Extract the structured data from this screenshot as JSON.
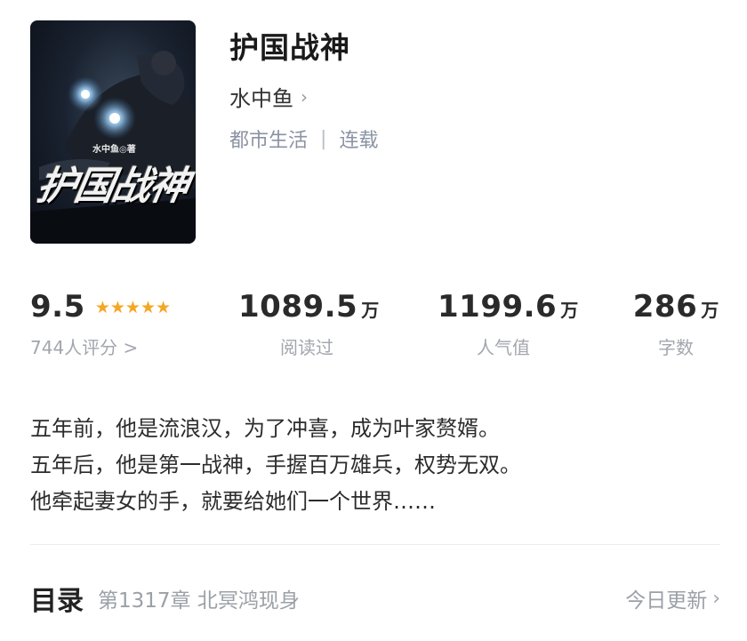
{
  "book": {
    "title": "护国战神",
    "cover_title": "护国战神",
    "cover_author": "水中鱼◎著",
    "author": "水中鱼",
    "author_chevron": "›",
    "category": "都市生活",
    "separator": "|",
    "status": "连载"
  },
  "stats": {
    "rating": {
      "value": "9.5",
      "stars": 5,
      "label": "744人评分 >"
    },
    "read": {
      "value": "1089.5",
      "unit": "万",
      "label": "阅读过"
    },
    "popularity": {
      "value": "1199.6",
      "unit": "万",
      "label": "人气值"
    },
    "words": {
      "value": "286",
      "unit": "万",
      "label": "字数"
    }
  },
  "intro": {
    "lines": [
      "五年前，他是流浪汉，为了冲喜，成为叶家赘婿。",
      "五年后，他是第一战神，手握百万雄兵，权势无双。",
      "他牵起妻女的手，就要给她们一个世界……"
    ]
  },
  "toc": {
    "title": "目录",
    "latest_chapter": "第1317章  北冥鸿现身",
    "update_label": "今日更新",
    "chevron": "›"
  },
  "colors": {
    "star": "#f5a623",
    "muted": "#9ba0a7",
    "meta": "#8a93a3"
  }
}
